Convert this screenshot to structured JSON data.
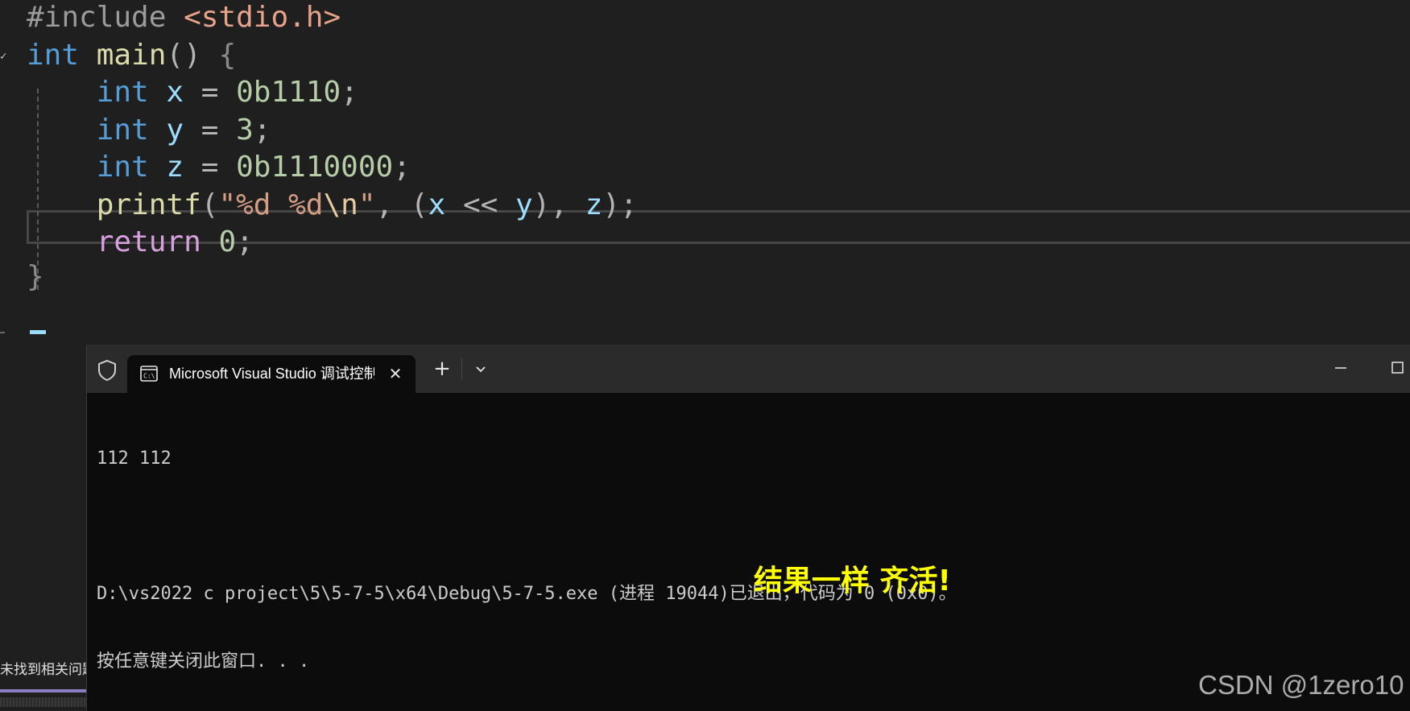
{
  "editor": {
    "lines": [
      {
        "tokens": [
          {
            "t": "#include ",
            "c": "pre"
          },
          {
            "t": "<stdio.h>",
            "c": "inc"
          }
        ]
      },
      {
        "tokens": [
          {
            "t": "int",
            "c": "kw"
          },
          {
            "t": " ",
            "c": "pun"
          },
          {
            "t": "main",
            "c": "fn"
          },
          {
            "t": "()",
            "c": "pun"
          },
          {
            "t": " {",
            "c": "pun-dim"
          }
        ]
      },
      {
        "tokens": [
          {
            "t": "    int",
            "c": "kw"
          },
          {
            "t": " ",
            "c": "pun"
          },
          {
            "t": "x",
            "c": "id"
          },
          {
            "t": " = ",
            "c": "pun"
          },
          {
            "t": "0b1110",
            "c": "num"
          },
          {
            "t": ";",
            "c": "pun"
          }
        ]
      },
      {
        "tokens": [
          {
            "t": "    int",
            "c": "kw"
          },
          {
            "t": " ",
            "c": "pun"
          },
          {
            "t": "y",
            "c": "id"
          },
          {
            "t": " = ",
            "c": "pun"
          },
          {
            "t": "3",
            "c": "num"
          },
          {
            "t": ";",
            "c": "pun"
          }
        ]
      },
      {
        "tokens": [
          {
            "t": "    int",
            "c": "kw"
          },
          {
            "t": " ",
            "c": "pun"
          },
          {
            "t": "z",
            "c": "id"
          },
          {
            "t": " = ",
            "c": "pun"
          },
          {
            "t": "0b1110000",
            "c": "num"
          },
          {
            "t": ";",
            "c": "pun"
          }
        ]
      },
      {
        "tokens": [
          {
            "t": "    printf",
            "c": "fn"
          },
          {
            "t": "(",
            "c": "pun"
          },
          {
            "t": "\"%d %d",
            "c": "str"
          },
          {
            "t": "\\n",
            "c": "esc"
          },
          {
            "t": "\"",
            "c": "str"
          },
          {
            "t": ", ",
            "c": "pun"
          },
          {
            "t": "(",
            "c": "pun"
          },
          {
            "t": "x",
            "c": "id"
          },
          {
            "t": " << ",
            "c": "pun"
          },
          {
            "t": "y",
            "c": "id"
          },
          {
            "t": "), ",
            "c": "pun"
          },
          {
            "t": "z",
            "c": "id"
          },
          {
            "t": ");",
            "c": "pun"
          }
        ]
      },
      {
        "tokens": [
          {
            "t": "    return",
            "c": "ctl"
          },
          {
            "t": " ",
            "c": "pun"
          },
          {
            "t": "0",
            "c": "num"
          },
          {
            "t": ";",
            "c": "pun"
          }
        ]
      },
      {
        "tokens": [
          {
            "t": "}",
            "c": "pun-dim"
          }
        ]
      }
    ]
  },
  "side_panel": {
    "status_text": "未找到相关问题"
  },
  "terminal": {
    "tab_title": "Microsoft Visual Studio 调试控制台",
    "tab_icon": "console-app-icon",
    "new_tab_label": "+",
    "close_label": "✕",
    "output": [
      "112 112",
      "",
      "D:\\vs2022 c project\\5\\5-7-5\\x64\\Debug\\5-7-5.exe (进程 19044)已退出，代码为 0 (0x0)。",
      "按任意键关闭此窗口. . ."
    ]
  },
  "overlay_note": "结果一样 齐活!",
  "watermark": "CSDN @1zero10",
  "colors": {
    "keyword": "#569cd6",
    "function": "#dcdcaa",
    "identifier": "#9cdcfe",
    "number": "#b5cea8",
    "string": "#d69d85",
    "control": "#d8a0df",
    "annotation": "#ffff00",
    "terminal_bg": "#0c0c0c",
    "editor_bg": "#1f1f1f"
  }
}
